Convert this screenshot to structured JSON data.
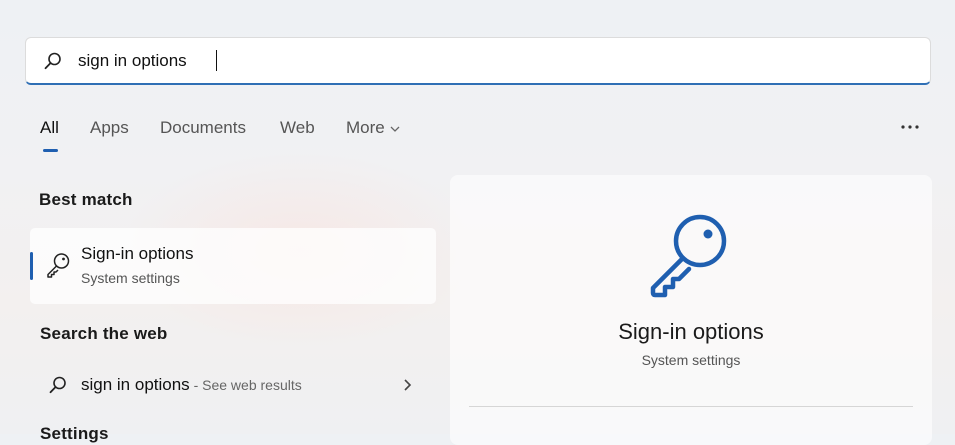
{
  "search": {
    "value": "sign in options",
    "placeholder": ""
  },
  "tabs": [
    {
      "label": "All"
    },
    {
      "label": "Apps"
    },
    {
      "label": "Documents"
    },
    {
      "label": "Web"
    },
    {
      "label": "More"
    }
  ],
  "best_match": {
    "heading": "Best match",
    "title": "Sign-in options",
    "subtitle": "System settings",
    "icon": "key-icon"
  },
  "search_web": {
    "heading": "Search the web",
    "query": "sign in options",
    "hint": " - See web results"
  },
  "settings_heading": "Settings",
  "preview": {
    "title": "Sign-in options",
    "subtitle": "System settings",
    "icon": "key-icon"
  },
  "colors": {
    "accent": "#1f5fb0",
    "key_blue": "#1f5fb0"
  }
}
